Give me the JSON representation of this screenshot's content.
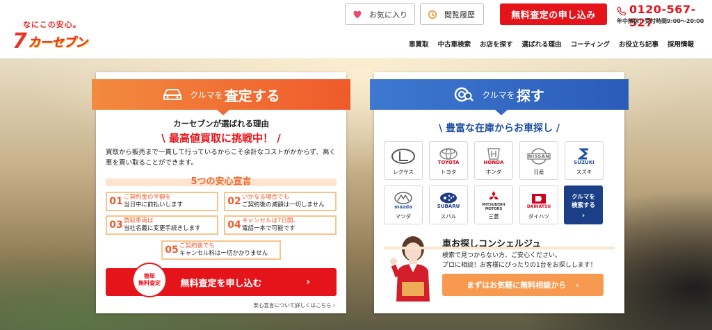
{
  "header": {
    "tagline": "なにこの安心。",
    "logo_mark": "7",
    "logo_text": "カーセブン",
    "favorites_label": "お気に入り",
    "history_label": "閲覧履歴",
    "assess_label": "無料査定の申し込み",
    "phone": "0120-567-527",
    "hours": "年中無休！受付時間9:00〜20:00"
  },
  "nav": [
    "車買取",
    "中古車検索",
    "お店を探す",
    "選ばれる理由",
    "コーティング",
    "お役立ち記事",
    "採用情報"
  ],
  "sell": {
    "tab_small": "クルマを",
    "tab_big": "査定する",
    "reason": "カーセブンが選ばれる理由",
    "challenge": "\\ 最高値買取に挑戦中！ /",
    "description": "買取から販売まで一貫して行っているからこそ余計なコストがかからず、高く車を買い取ることができます。",
    "promise_title": "5つの安心宣言",
    "promises": [
      {
        "num": "01",
        "line1": "ご契約金の半額を",
        "line2": "当日中に前払いします"
      },
      {
        "num": "02",
        "line1": "いかなる場合でも",
        "line2": "ご契約後の減額は一切しません"
      },
      {
        "num": "03",
        "line1": "買取車両は",
        "line2": "当社名義に変更手続きします"
      },
      {
        "num": "04",
        "line1": "キャンセルは7日間、",
        "line2": "電話一本で可能です"
      },
      {
        "num": "05",
        "line1": "ご契約後でも",
        "line2": "キャンセル料は一切かかりません"
      }
    ],
    "badge_line1": "簡単",
    "badge_line2": "無料査定",
    "cta": "無料査定を申し込む",
    "more_link": "安心宣言について詳しくはこちら ›"
  },
  "find": {
    "tab_small": "クルマを",
    "tab_big": "探す",
    "stock_title": "\\ 豊富な在庫からお車探し /",
    "makers": [
      {
        "name": "レクサス",
        "logo": "L",
        "color": "#555555"
      },
      {
        "name": "トヨタ",
        "logo": "TOYOTA",
        "color": "#d0021b"
      },
      {
        "name": "ホンダ",
        "logo": "HONDA",
        "color": "#d0021b"
      },
      {
        "name": "日産",
        "logo": "NISSAN",
        "color": "#666666"
      },
      {
        "name": "スズキ",
        "logo": "SUZUKI",
        "color": "#1f4fa6"
      },
      {
        "name": "マツダ",
        "logo": "mazda",
        "color": "#2c5aa0"
      },
      {
        "name": "スバル",
        "logo": "SUBARU",
        "color": "#1f3c88"
      },
      {
        "name": "三菱",
        "logo": "MITSUBISHI MOTORS",
        "color": "#d0021b"
      },
      {
        "name": "ダイハツ",
        "logo": "DAIHATSU",
        "color": "#d0021b"
      }
    ],
    "all_line1": "クルマを",
    "all_line2": "検索する",
    "concierge_title": "車お探しコンシェルジュ",
    "concierge_line1": "検索で見つからない方、ご安心ください。",
    "concierge_line2": "プロに相談！お客様にぴったりの1台をお探しします！",
    "cta": "まずはお気軽に無料相談から"
  },
  "colors": {
    "brand_red": "#e5141a",
    "orange": "#ef5a2b",
    "blue": "#2a5cb9",
    "navy": "#1a3f86"
  }
}
